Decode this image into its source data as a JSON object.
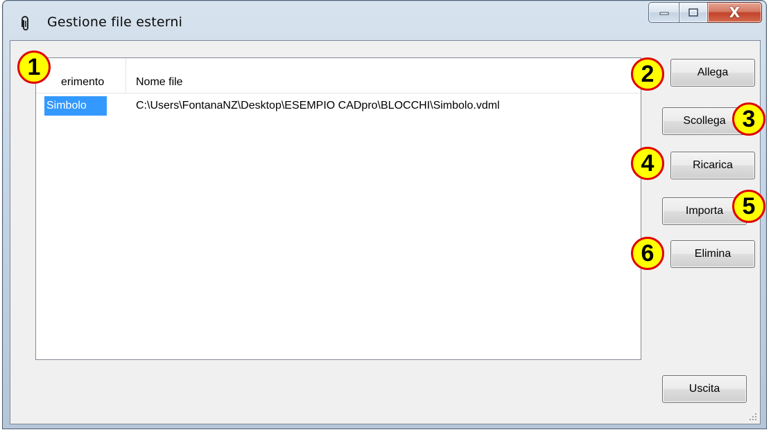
{
  "window": {
    "title": "Gestione file esterni",
    "icon": "paperclip-icon",
    "caption_buttons": {
      "minimize": "minimize-icon",
      "maximize": "maximize-icon",
      "close": "X"
    }
  },
  "list": {
    "columns": [
      "erimento",
      "Nome file"
    ],
    "rows": [
      {
        "riferimento": "Simbolo",
        "nome_file": "C:\\Users\\FontanaNZ\\Desktop\\ESEMPIO CADpro\\BLOCCHI\\Simbolo.vdml"
      }
    ]
  },
  "buttons": {
    "allega": "Allega",
    "scollega": "Scollega",
    "ricarica": "Ricarica",
    "importa": "Importa",
    "elimina": "Elimina",
    "uscita": "Uscita"
  },
  "callouts": [
    "1",
    "2",
    "3",
    "4",
    "5",
    "6"
  ],
  "colors": {
    "callout_fill": "#ffff00",
    "callout_border": "#e00000",
    "selection": "#3399ff"
  }
}
